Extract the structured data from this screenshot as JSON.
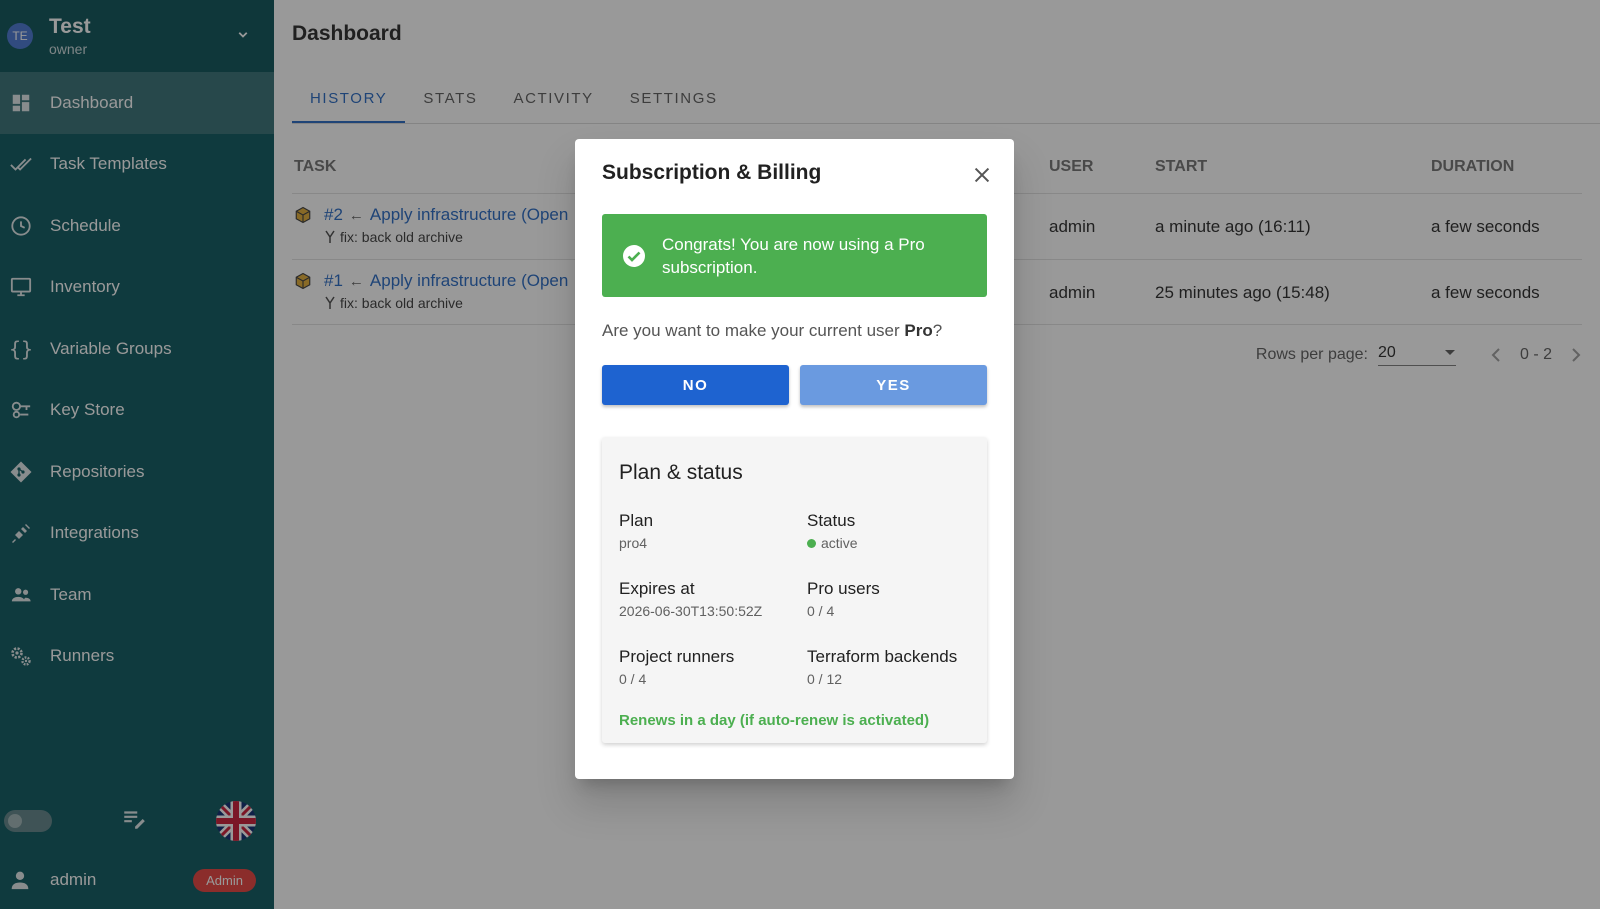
{
  "sidebar": {
    "project": {
      "avatar": "TE",
      "name": "Test",
      "role": "owner"
    },
    "items": [
      {
        "label": "Dashboard",
        "icon": "dashboard-icon",
        "active": true
      },
      {
        "label": "Task Templates",
        "icon": "done-all-icon"
      },
      {
        "label": "Schedule",
        "icon": "clock-icon"
      },
      {
        "label": "Inventory",
        "icon": "monitor-icon"
      },
      {
        "label": "Variable Groups",
        "icon": "braces-icon"
      },
      {
        "label": "Key Store",
        "icon": "key-icon"
      },
      {
        "label": "Repositories",
        "icon": "git-icon"
      },
      {
        "label": "Integrations",
        "icon": "plug-icon"
      },
      {
        "label": "Team",
        "icon": "team-icon"
      },
      {
        "label": "Runners",
        "icon": "cogs-icon"
      }
    ],
    "user": {
      "name": "admin",
      "badge": "Admin"
    }
  },
  "main": {
    "title": "Dashboard",
    "tabs": [
      "HISTORY",
      "STATS",
      "ACTIVITY",
      "SETTINGS"
    ],
    "table": {
      "headers": {
        "task": "TASK",
        "user": "USER",
        "start": "START",
        "duration": "DURATION"
      },
      "rows": [
        {
          "id": "#2",
          "name": "Apply infrastructure (Open",
          "commit": "fix: back old archive",
          "user": "admin",
          "start": "a minute ago (16:11)",
          "duration": "a few seconds"
        },
        {
          "id": "#1",
          "name": "Apply infrastructure (Open",
          "commit": "fix: back old archive",
          "user": "admin",
          "start": "25 minutes ago (15:48)",
          "duration": "a few seconds"
        }
      ]
    },
    "pagination": {
      "rows_label": "Rows per page:",
      "rows_value": "20",
      "range": "0 - 2"
    }
  },
  "dialog": {
    "title": "Subscription & Billing",
    "alert": "Congrats! You are now using a Pro subscription.",
    "question_prefix": "Are you want to make your current user ",
    "question_bold": "Pro",
    "question_suffix": "?",
    "no_label": "NO",
    "yes_label": "YES",
    "card": {
      "title": "Plan & status",
      "plan_label": "Plan",
      "plan_value": "pro4",
      "status_label": "Status",
      "status_value": "active",
      "expires_label": "Expires at",
      "expires_value": "2026-06-30T13:50:52Z",
      "pro_users_label": "Pro users",
      "pro_users_value": "0 / 4",
      "runners_label": "Project runners",
      "runners_value": "0 / 4",
      "tf_label": "Terraform backends",
      "tf_value": "0 / 12",
      "renew": "Renews in a day (if auto-renew is activated)"
    }
  },
  "colors": {
    "sidebar": "#005057",
    "accent": "#1e63c0",
    "success": "#4caf50",
    "danger": "#e53935"
  }
}
